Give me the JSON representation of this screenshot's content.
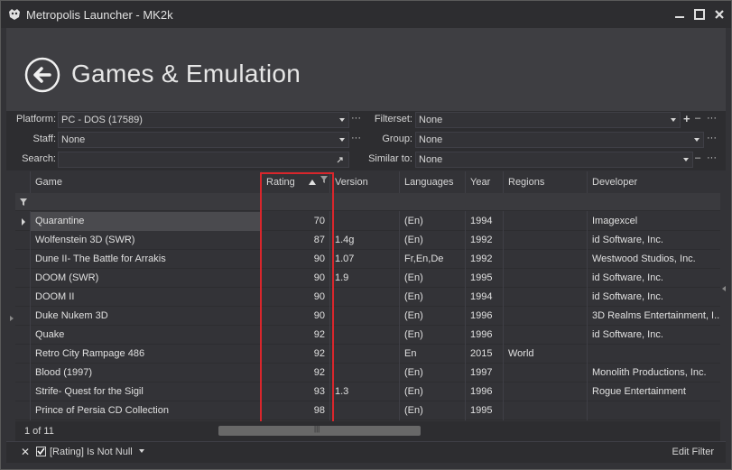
{
  "window": {
    "title": "Metropolis Launcher - MK2k"
  },
  "header": {
    "title": "Games & Emulation"
  },
  "filters": {
    "platform_label": "Platform:",
    "platform_value": "PC - DOS (17589)",
    "filterset_label": "Filterset:",
    "filterset_value": "None",
    "staff_label": "Staff:",
    "staff_value": "None",
    "group_label": "Group:",
    "group_value": "None",
    "search_label": "Search:",
    "search_value": "",
    "similar_label": "Similar to:",
    "similar_value": "None",
    "ellipsis": "···",
    "plus": "+",
    "minus": "–"
  },
  "grid": {
    "columns": [
      "Game",
      "Rating",
      "Version",
      "Languages",
      "Year",
      "Regions",
      "Developer"
    ],
    "rows": [
      {
        "game": "Quarantine",
        "rating": "70",
        "version": "",
        "languages": "(En)",
        "year": "1994",
        "regions": "",
        "developer": "Imagexcel"
      },
      {
        "game": "Wolfenstein 3D (SWR)",
        "rating": "87",
        "version": "1.4g",
        "languages": "(En)",
        "year": "1992",
        "regions": "",
        "developer": "id Software, Inc."
      },
      {
        "game": "Dune II- The Battle for Arrakis",
        "rating": "90",
        "version": "1.07",
        "languages": "Fr,En,De",
        "year": "1992",
        "regions": "",
        "developer": "Westwood Studios, Inc."
      },
      {
        "game": "DOOM (SWR)",
        "rating": "90",
        "version": "1.9",
        "languages": "(En)",
        "year": "1995",
        "regions": "",
        "developer": "id Software, Inc."
      },
      {
        "game": "DOOM II",
        "rating": "90",
        "version": "",
        "languages": "(En)",
        "year": "1994",
        "regions": "",
        "developer": "id Software, Inc."
      },
      {
        "game": "Duke Nukem 3D",
        "rating": "90",
        "version": "",
        "languages": "(En)",
        "year": "1996",
        "regions": "",
        "developer": "3D Realms Entertainment, I..."
      },
      {
        "game": "Quake",
        "rating": "92",
        "version": "",
        "languages": "(En)",
        "year": "1996",
        "regions": "",
        "developer": "id Software, Inc."
      },
      {
        "game": "Retro City Rampage 486",
        "rating": "92",
        "version": "",
        "languages": "En",
        "year": "2015",
        "regions": "World",
        "developer": ""
      },
      {
        "game": "Blood (1997)",
        "rating": "92",
        "version": "",
        "languages": "(En)",
        "year": "1997",
        "regions": "",
        "developer": "Monolith Productions, Inc."
      },
      {
        "game": "Strife- Quest for the Sigil",
        "rating": "93",
        "version": "1.3",
        "languages": "(En)",
        "year": "1996",
        "regions": "",
        "developer": "Rogue Entertainment"
      },
      {
        "game": "Prince of Persia CD Collection",
        "rating": "98",
        "version": "",
        "languages": "(En)",
        "year": "1995",
        "regions": "",
        "developer": ""
      }
    ]
  },
  "pager": {
    "text": "1 of 11",
    "thumb_grip": "|||"
  },
  "status": {
    "filter_text": "[Rating] Is Not Null",
    "edit_filter": "Edit Filter",
    "close": "✕"
  },
  "colors": {
    "highlight": "#d9262c",
    "background": "#2d2d30",
    "panel": "#3e3e42"
  }
}
